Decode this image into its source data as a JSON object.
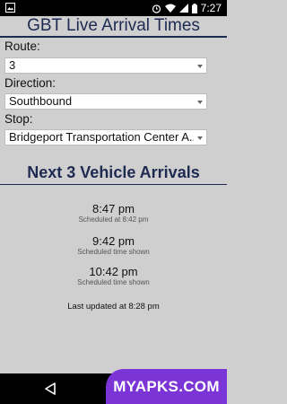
{
  "status_bar": {
    "time": "7:27",
    "left_icon": "image-icon",
    "icons": [
      "alarm-icon",
      "wifi-icon",
      "signal-icon",
      "battery-icon"
    ]
  },
  "header": {
    "title": "GBT Live Arrival Times"
  },
  "form": {
    "route_label": "Route:",
    "route_value": "3",
    "direction_label": "Direction:",
    "direction_value": "Southbound",
    "stop_label": "Stop:",
    "stop_value": "Bridgeport Transportation Center A..."
  },
  "arrivals": {
    "heading": "Next 3 Vehicle Arrivals",
    "items": [
      {
        "time": "8:47 pm",
        "note": "Scheduled at 8:42 pm"
      },
      {
        "time": "9:42 pm",
        "note": "Scheduled time shown"
      },
      {
        "time": "10:42 pm",
        "note": "Scheduled time shown"
      }
    ],
    "last_updated": "Last updated at 8:28 pm"
  },
  "nav_bar": {
    "icons": [
      "back-icon",
      "home-icon"
    ]
  },
  "watermark": {
    "text": "MYAPKS.COM"
  },
  "colors": {
    "title": "#1d2a52",
    "background": "#cfcfcf",
    "watermark": "#7b34d6"
  }
}
